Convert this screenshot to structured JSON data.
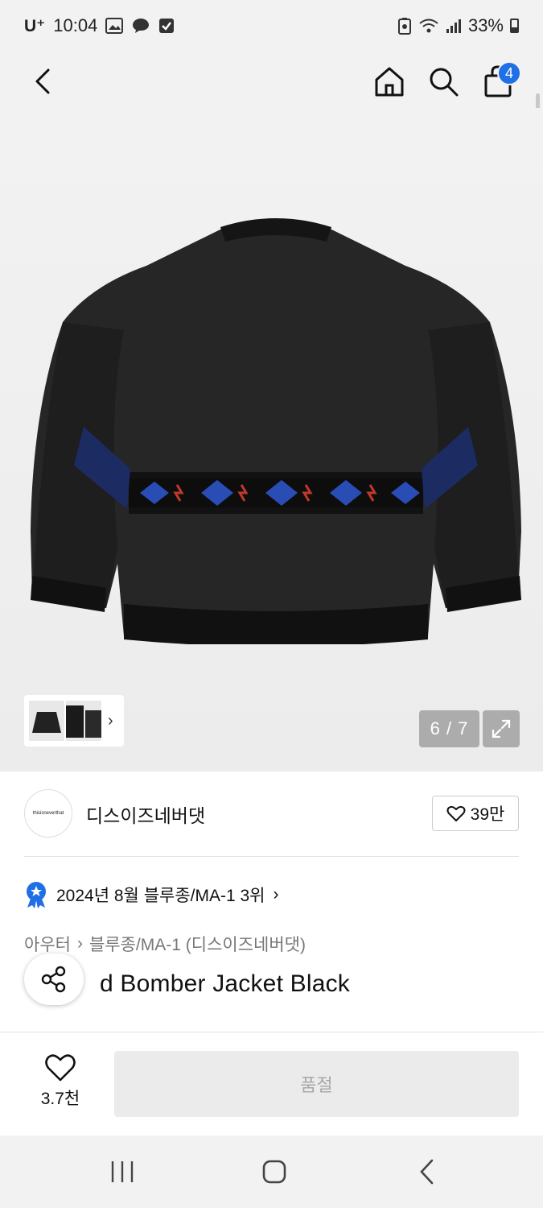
{
  "status_bar": {
    "carrier": "U⁺",
    "time": "10:04",
    "battery": "33%",
    "icons": [
      "gallery-icon",
      "chat-icon",
      "check-icon",
      "battery-saver-icon",
      "wifi-icon",
      "signal-icon"
    ]
  },
  "nav": {
    "cart_count": "4",
    "icons": [
      "back-arrow-icon",
      "home-icon",
      "search-icon",
      "shopping-bag-icon"
    ]
  },
  "gallery": {
    "counter": "6 / 7",
    "current_index": 6,
    "total": 7,
    "thumb_chevron": "›"
  },
  "brand": {
    "logo_text": "thisisneverthat",
    "name": "디스이즈네버댓",
    "likes": "39만"
  },
  "ranking": {
    "label": "2024년 8월 블루종/MA-1 3위",
    "chevron": "›"
  },
  "breadcrumb": {
    "level1": "아우터",
    "separator": "›",
    "level2": "블루종/MA-1 (디스이즈네버댓)"
  },
  "product": {
    "title_visible": "d Bomber Jacket Black"
  },
  "bottom": {
    "wish_count": "3.7천",
    "buy_button": "품절"
  },
  "colors": {
    "accent": "#1f6fe5",
    "soldout_bg": "#ebebeb",
    "soldout_text": "#a8a8a8"
  }
}
